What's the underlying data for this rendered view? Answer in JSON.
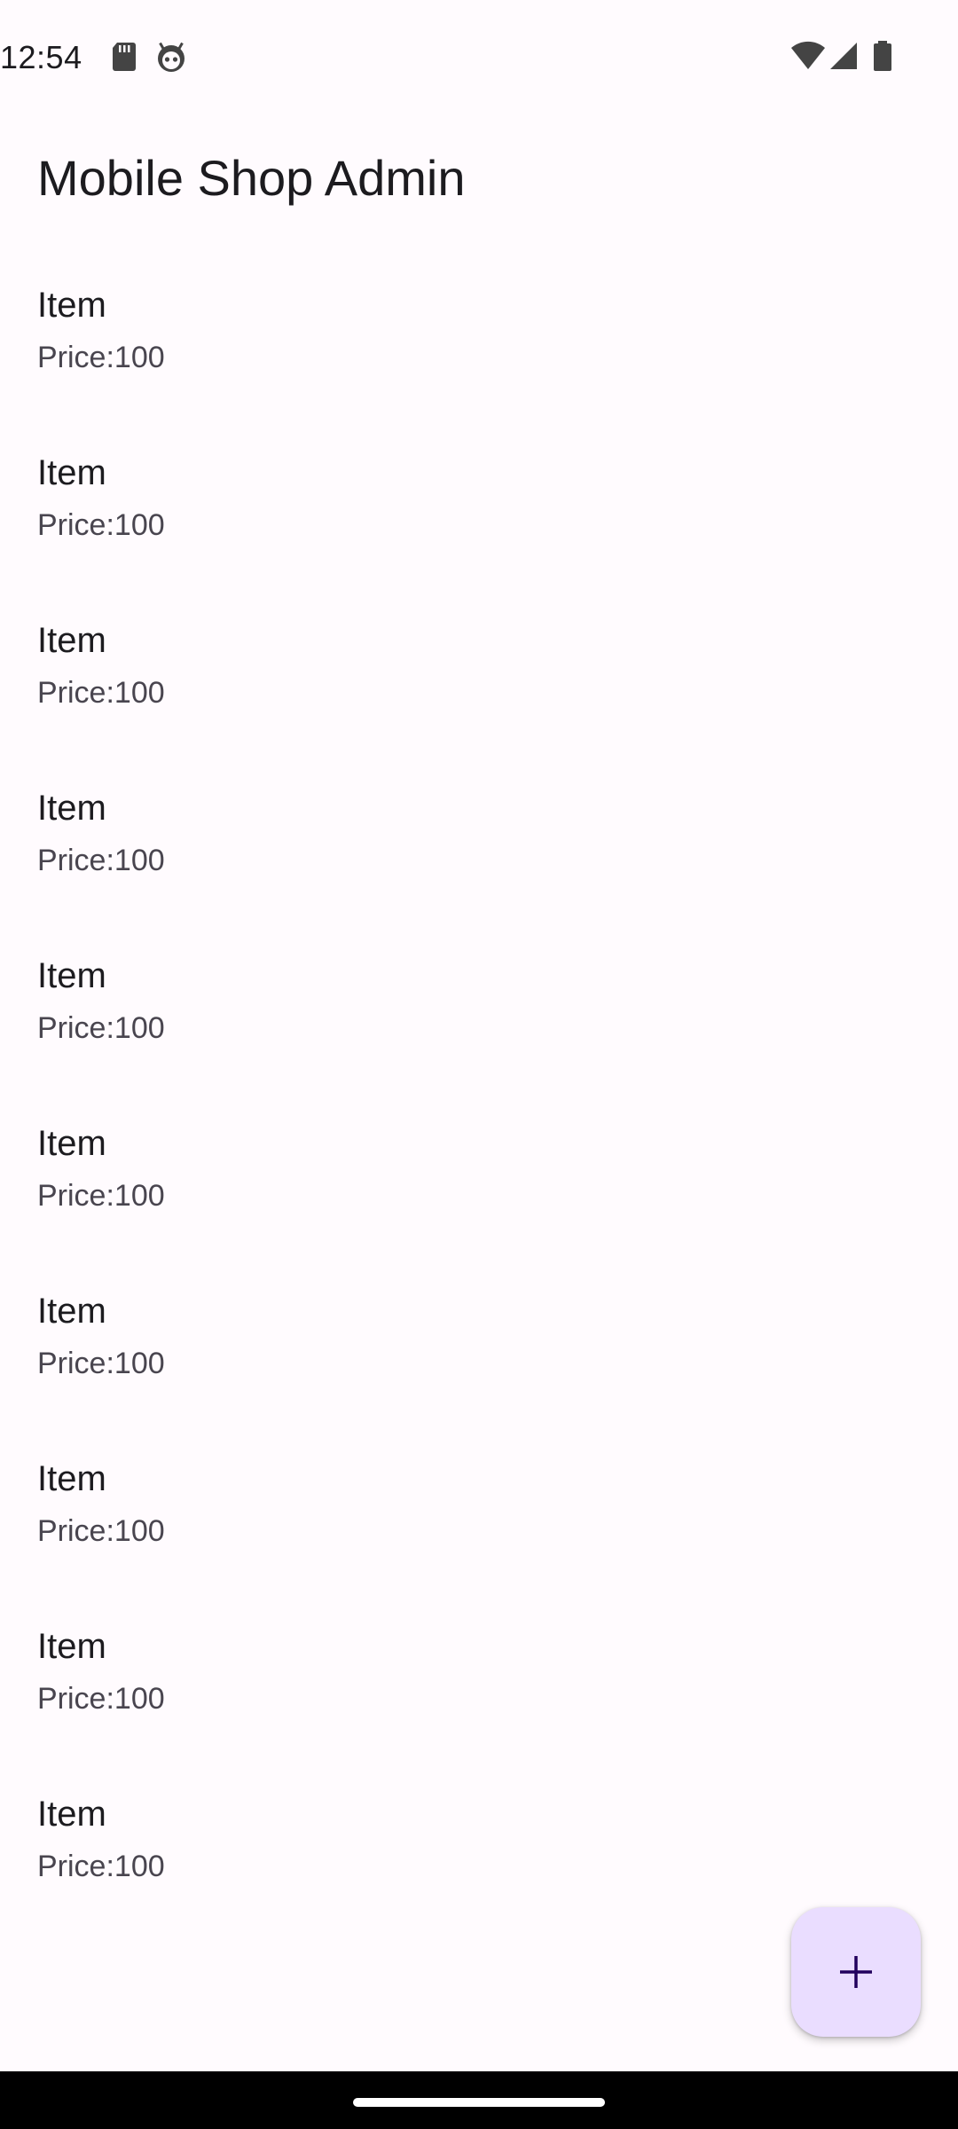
{
  "status_bar": {
    "time": "12:54",
    "icons": [
      "sd-card-icon",
      "android-head-icon",
      "wifi-icon",
      "signal-icon",
      "battery-icon"
    ]
  },
  "app_bar": {
    "title": "Mobile Shop Admin"
  },
  "items": [
    {
      "title": "Item",
      "subtitle": "Price:100"
    },
    {
      "title": "Item",
      "subtitle": "Price:100"
    },
    {
      "title": "Item",
      "subtitle": "Price:100"
    },
    {
      "title": "Item",
      "subtitle": "Price:100"
    },
    {
      "title": "Item",
      "subtitle": "Price:100"
    },
    {
      "title": "Item",
      "subtitle": "Price:100"
    },
    {
      "title": "Item",
      "subtitle": "Price:100"
    },
    {
      "title": "Item",
      "subtitle": "Price:100"
    },
    {
      "title": "Item",
      "subtitle": "Price:100"
    },
    {
      "title": "Item",
      "subtitle": "Price:100"
    }
  ],
  "fab": {
    "icon": "plus-icon"
  },
  "colors": {
    "background": "#fffbfe",
    "fab_background": "#eaddff",
    "fab_icon": "#21005d",
    "text_primary": "#1c1b1f",
    "text_secondary": "#49454f"
  }
}
